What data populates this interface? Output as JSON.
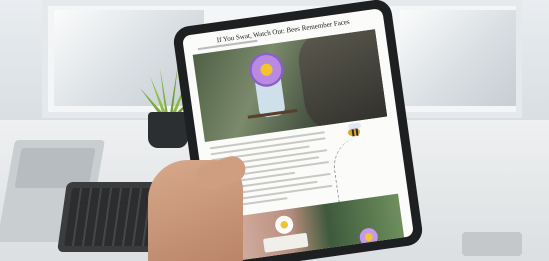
{
  "article": {
    "headline": "If You Swat, Watch Out: Bees Remember Faces"
  }
}
